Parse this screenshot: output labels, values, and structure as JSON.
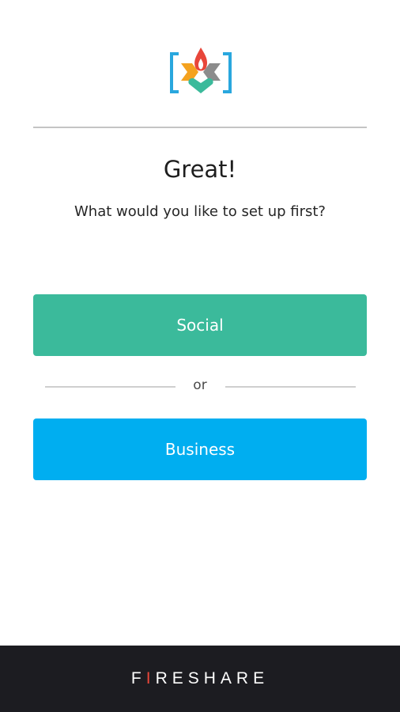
{
  "logo": {
    "icon": "fireshare-logo-icon",
    "colors": {
      "bracket": "#29a7de",
      "flame": "#e8463a",
      "left_wing": "#f4a21f",
      "right_wing": "#8c8c8c",
      "bottom": "#3bba9b"
    }
  },
  "heading": {
    "title": "Great!",
    "subtitle": "What would you like to set up first?"
  },
  "options": {
    "social_label": "Social",
    "divider_label": "or",
    "business_label": "Business"
  },
  "footer": {
    "brand_prefix": "F",
    "brand_accent": "I",
    "brand_suffix": "RESHARE"
  },
  "colors": {
    "social_button": "#3bba9b",
    "business_button": "#00aef0",
    "footer_bg": "#1c1c21",
    "brand_accent": "#e8463a"
  }
}
